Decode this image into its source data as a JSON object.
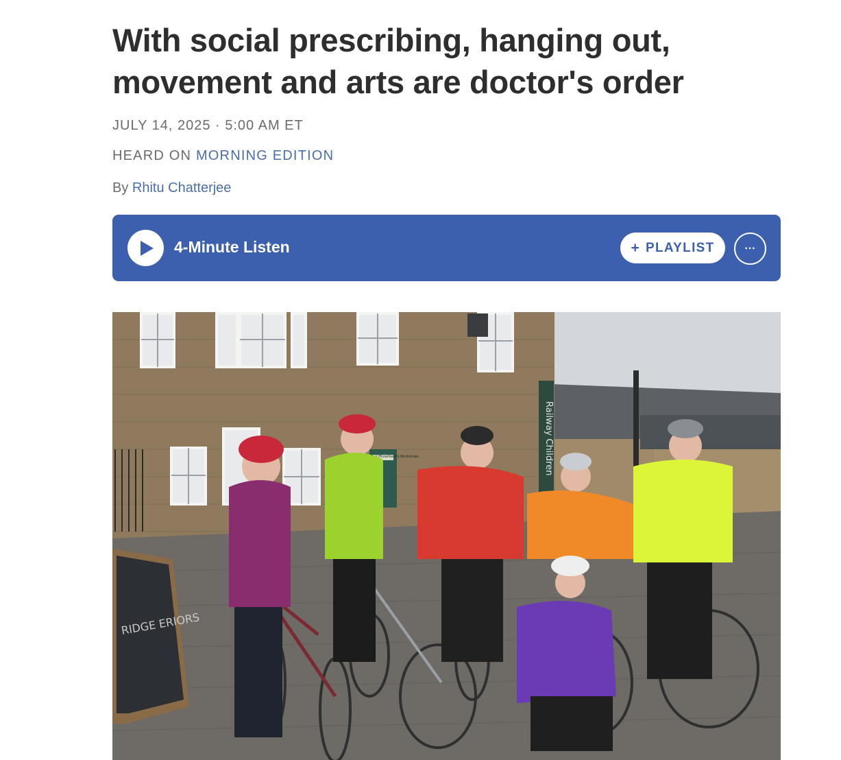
{
  "article": {
    "headline": "With social prescribing, hanging out, movement and arts are doctor's order",
    "dateline": "JULY 14, 2025 · 5:00 AM ET",
    "heard_on_prefix": "HEARD ON",
    "heard_on_show": "MORNING EDITION",
    "byline_prefix": "By",
    "author": "Rhitu Chatterjee"
  },
  "player": {
    "listen_label": "4-Minute Listen",
    "playlist_label": "PLAYLIST",
    "more_label": "···",
    "accent_color": "#3c60ae"
  },
  "photo": {
    "sign_text": "Railway Children",
    "poster_text": "Earl Fitzwilliam's Workshops",
    "chalkboard_text": "RIDGE ERIORS"
  }
}
